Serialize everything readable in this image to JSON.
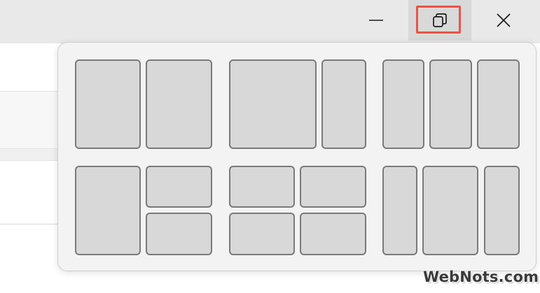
{
  "window": {
    "caption_buttons": [
      {
        "name": "minimize",
        "icon": "minimize-icon"
      },
      {
        "name": "maximize-restore",
        "icon": "restore-icon",
        "highlighted": true
      },
      {
        "name": "close",
        "icon": "close-icon"
      }
    ],
    "highlight_color": "#e8534a"
  },
  "snap_layouts": {
    "rows": [
      [
        {
          "layout": "two-equal-columns",
          "zones": 2
        },
        {
          "layout": "wide-left-narrow-right",
          "zones": 2
        },
        {
          "layout": "three-equal-columns",
          "zones": 3
        }
      ],
      [
        {
          "layout": "left-half-right-stacked",
          "zones": 3
        },
        {
          "layout": "four-quadrants",
          "zones": 4
        },
        {
          "layout": "narrow-wide-narrow",
          "zones": 3
        }
      ]
    ]
  },
  "watermark": {
    "text": "WebNots.com"
  }
}
